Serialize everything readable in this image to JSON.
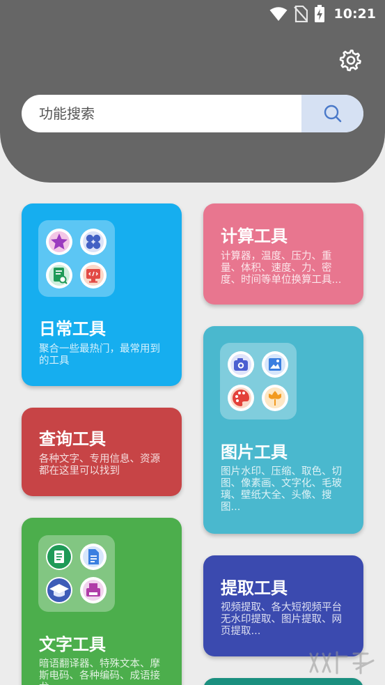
{
  "status_bar": {
    "time": "10:21",
    "icons": [
      "wifi-icon",
      "no-sim-icon",
      "battery-charging-icon"
    ]
  },
  "header": {
    "settings_icon": "gear-icon",
    "search": {
      "placeholder": "功能搜索",
      "value": "",
      "button_icon": "search-icon"
    }
  },
  "colors": {
    "header": "#666666",
    "background": "#ececec",
    "daily": "#16aeef",
    "calc": "#e8768f",
    "query": "#c74446",
    "image": "#4ab8ce",
    "text": "#4cae4c",
    "extract": "#3b4aaf",
    "partial_card": "#1a8f7f"
  },
  "cards": {
    "daily": {
      "title": "日常工具",
      "desc": "聚合一些最热门，最常用到的工具",
      "icons": [
        "star-icon",
        "clover-icon",
        "document-search-icon",
        "code-monitor-icon"
      ]
    },
    "calc": {
      "title": "计算工具",
      "desc": "计算器，温度、压力、重量、体积、速度、力、密度、时间等单位换算工具..."
    },
    "query": {
      "title": "查询工具",
      "desc": "各种文字、专用信息、资源都在这里可以找到"
    },
    "image": {
      "title": "图片工具",
      "desc": "图片水印、压缩、取色、切图、像素画、文字化、毛玻璃、壁纸大全、头像、搜图...",
      "icons": [
        "camera-icon",
        "picture-icon",
        "palette-icon",
        "flower-icon"
      ]
    },
    "text": {
      "title": "文字工具",
      "desc": "暗语翻译器、特殊文本、摩斯电码、各种编码、成语接龙",
      "icons": [
        "notes-icon",
        "file-icon",
        "graduation-cap-icon",
        "printer-icon"
      ]
    },
    "extract": {
      "title": "提取工具",
      "desc": "视频提取、各大短视频平台无水印提取、图片提取、网页提取..."
    }
  }
}
